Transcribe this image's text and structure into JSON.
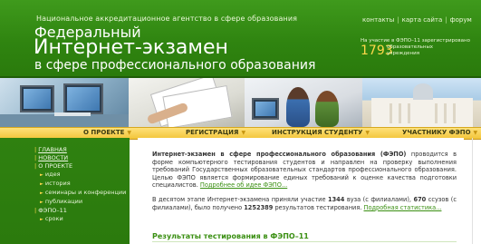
{
  "header": {
    "agency": "Национальное аккредитационное агентство в сфере образования",
    "title_line1": "Федеральный",
    "title_line2": "Интернет-экзамен",
    "title_line3": "в сфере профессионального образования",
    "top_links": [
      "контакты",
      "карта сайта",
      "форум"
    ],
    "counter_label": "На участие в ФЭПО–11 зарегистрировано",
    "counter_value": "1793",
    "counter_unit": "образовательных учреждения"
  },
  "nav": {
    "items": [
      "О ПРОЕКТЕ",
      "РЕГИСТРАЦИЯ",
      "ИНСТРУКЦИЯ СТУДЕНТУ",
      "УЧАСТНИКУ ФЭПО"
    ],
    "arrow": "▼"
  },
  "sidebar": {
    "items": [
      {
        "label": "ГЛАВНАЯ",
        "type": "top"
      },
      {
        "label": "НОВОСТИ",
        "type": "top"
      },
      {
        "label": "О ПРОЕКТЕ",
        "type": "top"
      },
      {
        "label": "идея",
        "type": "sub"
      },
      {
        "label": "история",
        "type": "sub"
      },
      {
        "label": "семинары и конференции",
        "type": "sub"
      },
      {
        "label": "публикации",
        "type": "sub"
      },
      {
        "label": "ФЭПО–11",
        "type": "top"
      },
      {
        "label": "сроки",
        "type": "sub"
      }
    ]
  },
  "main": {
    "para1_bold": "Интернет-экзамен в сфере профессионального образования (ФЭПО)",
    "para1_text": " проводится в форме компьютерного тестирования студентов и направлен на проверку выполнения требований Государственных образовательных стандартов профессионального образования. Целью ФЭПО является формирование единых требований к оценке качества подготовки специалистов.",
    "para1_link": "Подробнее об идее ФЭПО...",
    "para2_a": "В десятом этапе Интернет-экзамена приняли участие ",
    "para2_n1": "1344",
    "para2_b": " вуза (с филиалами), ",
    "para2_n2": "670",
    "para2_c": " ссузов (с филиалами), было получено ",
    "para2_n3": "1252389",
    "para2_d": " результатов тестирования.",
    "para2_link": "Подробная статистика...",
    "results_title": "Результаты тестирования в ФЭПО–11"
  },
  "colors": {
    "header_green": "#2f8410",
    "nav_yellow": "#f2c53a",
    "counter_yellow": "#ffd84a",
    "link_green": "#3a8f12"
  }
}
